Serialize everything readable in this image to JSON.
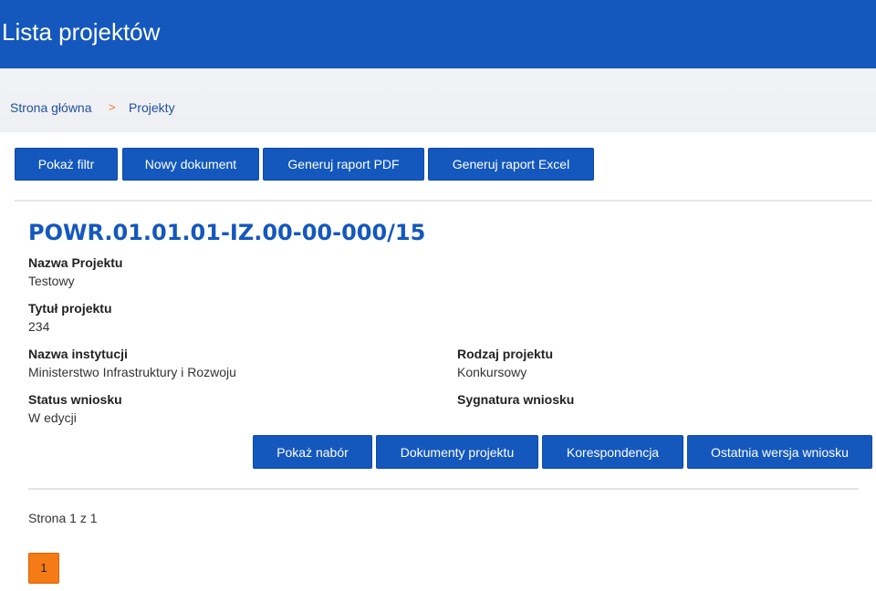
{
  "header": {
    "title": "Lista projektów"
  },
  "breadcrumb": {
    "home": "Strona główna",
    "separator": ">",
    "current": "Projekty"
  },
  "toolbar": {
    "show_filter": "Pokaż filtr",
    "new_document": "Nowy dokument",
    "pdf_report": "Generuj raport PDF",
    "excel_report": "Generuj raport Excel"
  },
  "project": {
    "id": "POWR.01.01.01-IZ.00-00-000/15",
    "fields": {
      "name_label": "Nazwa Projektu",
      "name_value": "Testowy",
      "title_label": "Tytuł projektu",
      "title_value": "234",
      "institution_label": "Nazwa instytucji",
      "institution_value": "Ministerstwo Infrastruktury i Rozwoju",
      "type_label": "Rodzaj projektu",
      "type_value": "Konkursowy",
      "status_label": "Status wniosku",
      "status_value": "W edycji",
      "signature_label": "Sygnatura wniosku",
      "signature_value": ""
    },
    "actions": {
      "show_call": "Pokaż nabór",
      "project_documents": "Dokumenty projektu",
      "correspondence": "Korespondencja",
      "latest_version": "Ostatnia wersja wniosku"
    }
  },
  "pagination": {
    "summary": "Strona 1 z 1",
    "current_page": "1"
  },
  "colors": {
    "primary": "#1458bd",
    "accent": "#f47b16"
  }
}
